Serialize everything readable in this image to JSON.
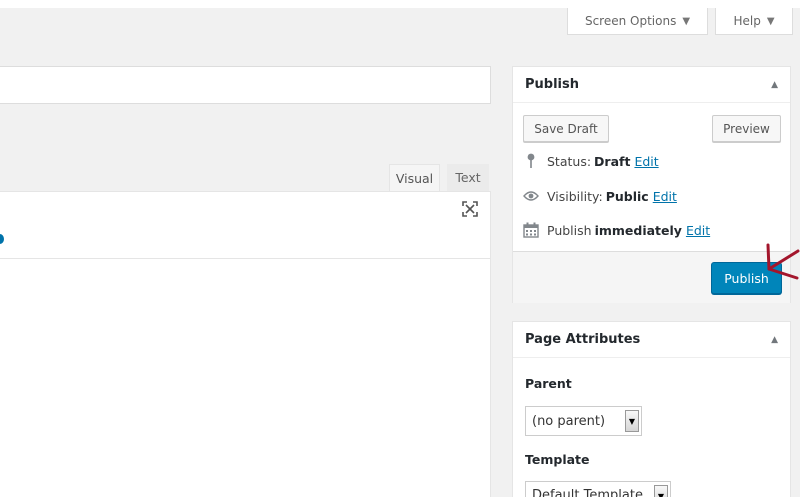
{
  "header": {
    "screen_options_label": "Screen Options",
    "help_label": "Help",
    "caret": "▼"
  },
  "editor": {
    "tabs": [
      {
        "label": "Visual"
      },
      {
        "label": "Text"
      }
    ]
  },
  "publish_box": {
    "title": "Publish",
    "toggle": "▲",
    "save_draft_label": "Save Draft",
    "preview_label": "Preview",
    "status": {
      "label": "Status:",
      "value": "Draft",
      "link": "Edit"
    },
    "visibility": {
      "label": "Visibility:",
      "value": "Public",
      "link": "Edit"
    },
    "publish_time": {
      "label": "Publish",
      "value": "immediately",
      "link": "Edit"
    },
    "publish_button_label": "Publish"
  },
  "page_attributes": {
    "title": "Page Attributes",
    "toggle": "▲",
    "parent_label": "Parent",
    "parent_value": "(no parent)",
    "template_label": "Template",
    "template_value": "Default Template"
  },
  "colors": {
    "primary_button": "#0085ba",
    "link": "#0073aa",
    "annotation_arrow": "#a3162c"
  }
}
